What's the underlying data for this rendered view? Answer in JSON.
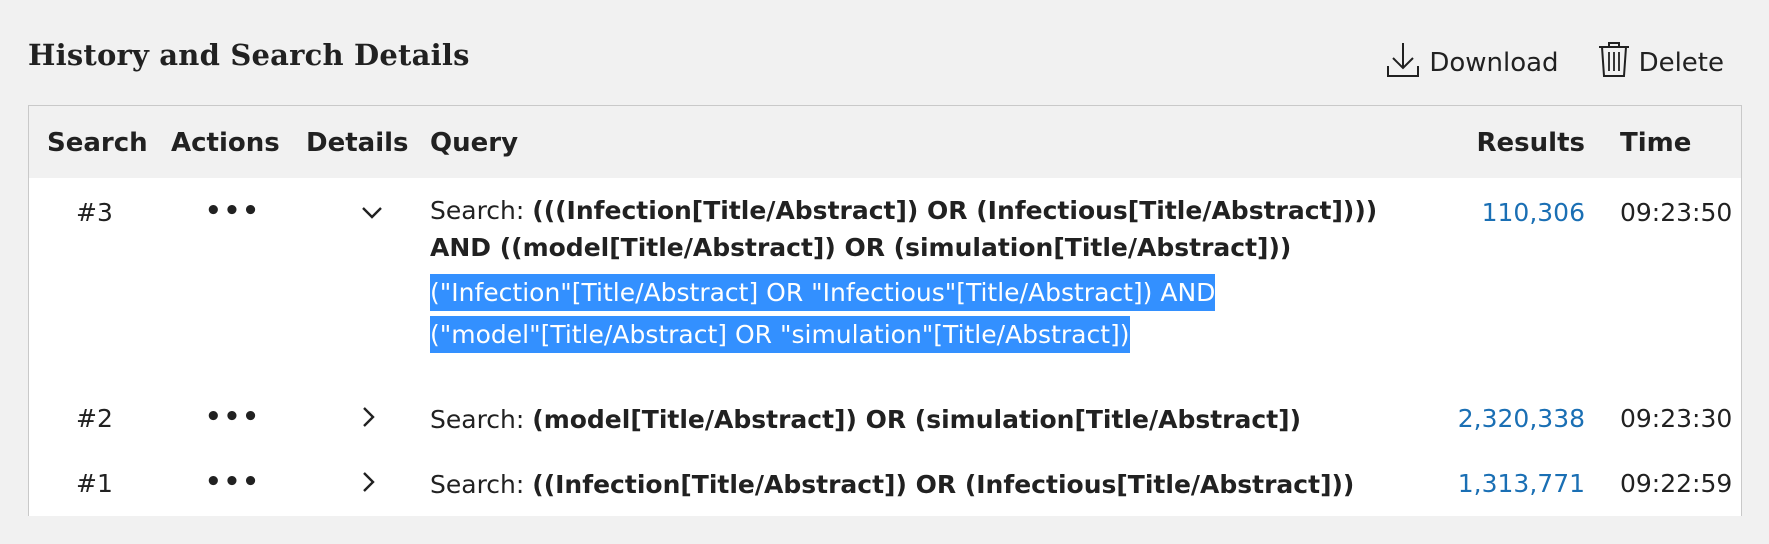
{
  "header": {
    "title": "History and Search Details",
    "download_label": "Download",
    "delete_label": "Delete"
  },
  "table": {
    "columns": [
      "Search",
      "Actions",
      "Details",
      "Query",
      "Results",
      "Time"
    ],
    "rows": [
      {
        "number": "#3",
        "actions": "•••",
        "expanded": true,
        "query_prefix": "Search:",
        "query": "(((Infection[Title/Abstract]) OR (Infectious[Title/Abstract]))) AND ((model[Title/Abstract]) OR (simulation[Title/Abstract]))",
        "translation": "(\"Infection\"[Title/Abstract] OR \"Infectious\"[Title/Abstract]) AND (\"model\"[Title/Abstract] OR \"simulation\"[Title/Abstract])",
        "results": "110,306",
        "time": "09:23:50"
      },
      {
        "number": "#2",
        "actions": "•••",
        "expanded": false,
        "query_prefix": "Search:",
        "query": "(model[Title/Abstract]) OR (simulation[Title/Abstract])",
        "results": "2,320,338",
        "time": "09:23:30"
      },
      {
        "number": "#1",
        "actions": "•••",
        "expanded": false,
        "query_prefix": "Search:",
        "query": "((Infection[Title/Abstract]) OR (Infectious[Title/Abstract]))",
        "results": "1,313,771",
        "time": "09:22:59"
      }
    ]
  },
  "colors": {
    "link": "#1a6fb4",
    "selection": "#3390ff",
    "background": "#f1f1f1"
  },
  "icons": {
    "download": "download-icon",
    "delete": "trash-icon",
    "expanded": "chevron-down-icon",
    "collapsed": "chevron-right-icon",
    "actions": "more-horizontal-icon"
  }
}
